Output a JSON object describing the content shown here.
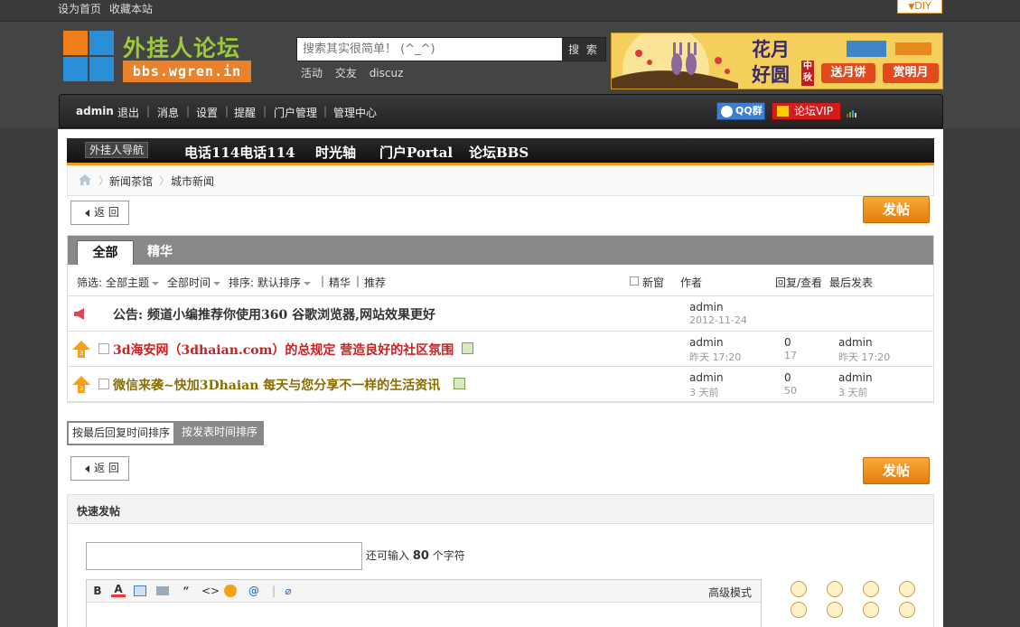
{
  "topbar": {
    "set_home": "设为首页",
    "bookmark": "收藏本站",
    "diy": "DIY"
  },
  "header": {
    "logo_text": "外挂人论坛",
    "logo_url": "bbs.wgren.in",
    "search_placeholder": "搜索其实很简单！ (^_^)",
    "search_button": "搜 索",
    "hotwords": [
      "活动",
      "交友",
      "discuz"
    ],
    "banner": {
      "title_line1": "花月",
      "title_line2": "好圆",
      "tag": "中秋",
      "button1": "送月饼",
      "button2": "赏明月"
    }
  },
  "navbar": {
    "user": "admin",
    "items": [
      "退出",
      "消息",
      "设置",
      "提醒",
      "门户管理",
      "管理中心"
    ],
    "qq_button": "QQ群",
    "vip_button": "论坛VIP"
  },
  "subnav": {
    "tag": "外挂人导航",
    "items": [
      "电话114电话114",
      "时光轴",
      "门户Portal",
      "论坛BBS"
    ]
  },
  "breadcrumb": [
    "新闻茶馆",
    "城市新闻"
  ],
  "buttons": {
    "back": "返 回",
    "post": "发帖"
  },
  "thread_list": {
    "tabs": [
      "全部",
      "精华"
    ],
    "filter": {
      "label": "筛选:",
      "topic": "全部主题",
      "time": "全部时间",
      "sort": "排序: 默认排序",
      "digest": "精华",
      "recommend": "推荐",
      "new_window": "新窗",
      "col_author": "作者",
      "col_reply": "回复/查看",
      "col_last": "最后发表"
    },
    "rows": [
      {
        "type": "announcement",
        "title": "公告: 频道小编推荐你使用360 谷歌浏览器,网站效果更好",
        "title_color": "#333333",
        "author": "admin",
        "date": "2012-11-24",
        "replies": "",
        "views": "",
        "last_user": "",
        "last_time": ""
      },
      {
        "type": "sticky",
        "title": "3d海安网（3dhaian.com）的总规定 营造良好的社区氛围",
        "title_color": "#cc2020",
        "author": "admin",
        "date": "昨天 17:20",
        "replies": "0",
        "views": "17",
        "last_user": "admin",
        "last_time": "昨天 17:20"
      },
      {
        "type": "sticky",
        "title": "微信来袭~快加3Dhaian 每天与您分享不一样的生活资讯",
        "title_color": "#8a6d00",
        "author": "admin",
        "date": "3 天前",
        "replies": "0",
        "views": "50",
        "last_user": "admin",
        "last_time": "3 天前"
      }
    ]
  },
  "sort_tabs": [
    "按最后回复时间排序",
    "按发表时间排序"
  ],
  "quick_post": {
    "title": "快速发帖",
    "remain_prefix": "还可输入",
    "remain_count": "80",
    "remain_suffix": "个字符",
    "advanced_mode": "高级模式"
  },
  "colors": {
    "accent_orange": "#f19c1d",
    "announcement_red": "#e0455a",
    "sticky_orange": "#f5a11b"
  }
}
